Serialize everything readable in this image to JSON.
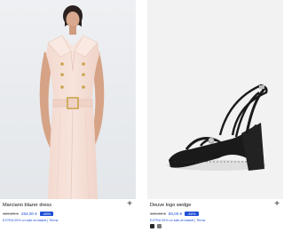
{
  "products": [
    {
      "name": "Marciano blazer dress",
      "old_price": "429,00 €",
      "new_price": "264,00 €",
      "discount": "-38%",
      "promo": "EXTRA 20% on sale at basket | Terms",
      "image_icon": "dress-photo",
      "add_icon": "+"
    },
    {
      "name": "Deuve logo wedge",
      "old_price": "159,00 €",
      "new_price": "80,00 €",
      "discount": "-50%",
      "promo": "EXTRA 20% on sale at basket | Terms",
      "image_icon": "sandal-photo",
      "add_icon": "+",
      "swatches": [
        "#262626",
        "#7a7a7a"
      ]
    }
  ],
  "colors": {
    "accent": "#1f4fd6",
    "muted": "#8a8a8a"
  }
}
